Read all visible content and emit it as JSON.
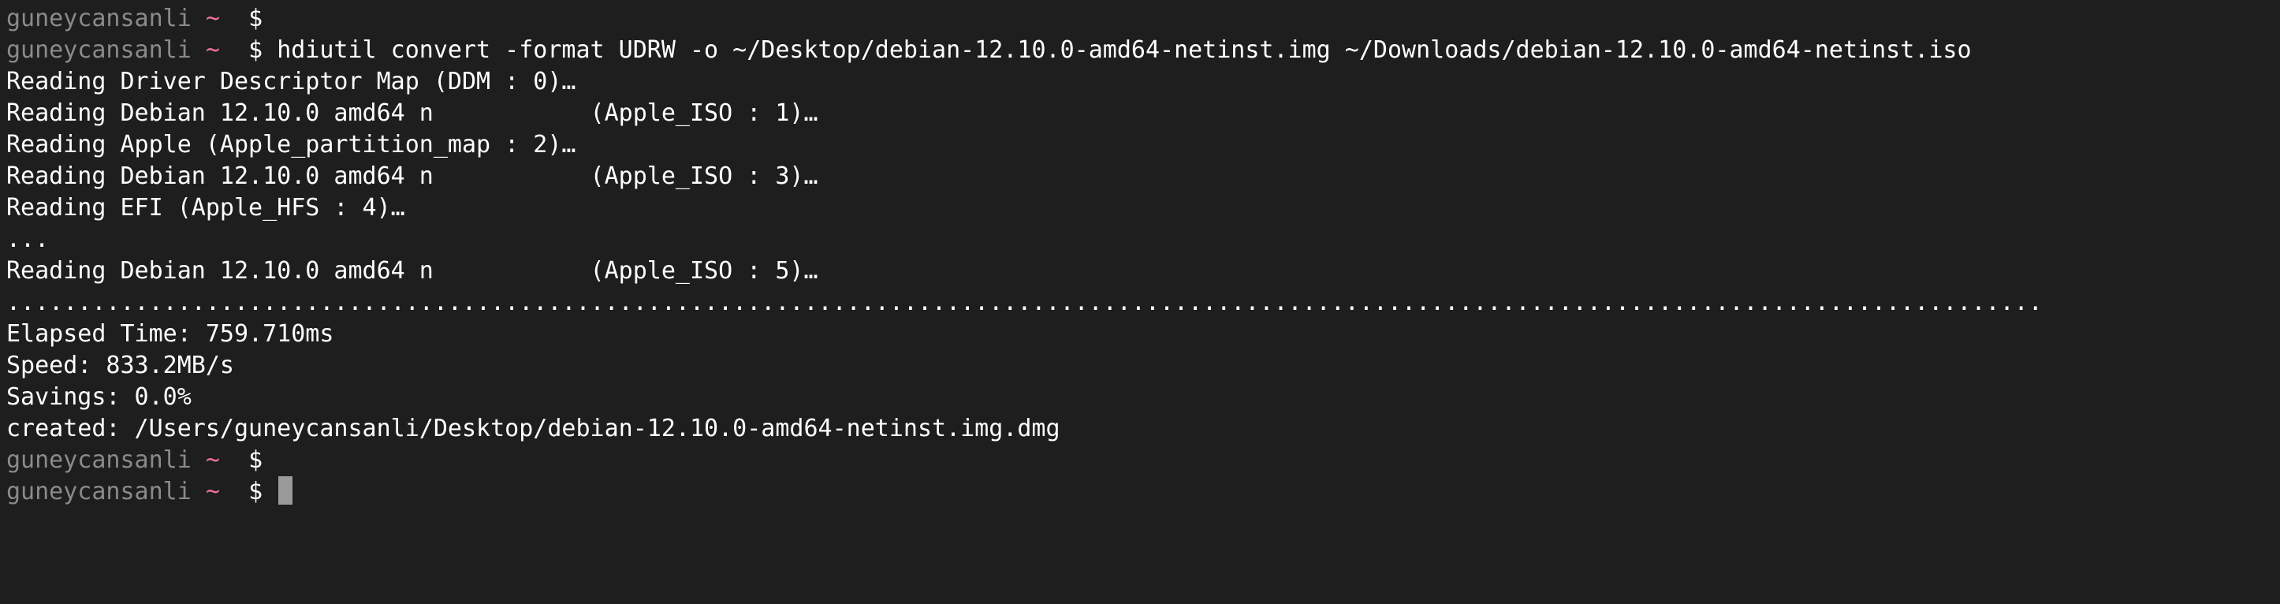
{
  "prompt": {
    "user": "guneycansanli",
    "tilde": "~",
    "symbol": "$"
  },
  "command": "hdiutil convert -format UDRW -o ~/Desktop/debian-12.10.0-amd64-netinst.img ~/Downloads/debian-12.10.0-amd64-netinst.iso",
  "output": {
    "lines": [
      "Reading Driver Descriptor Map (DDM : 0)…",
      "Reading Debian 12.10.0 amd64 n           (Apple_ISO : 1)…",
      "Reading Apple (Apple_partition_map : 2)…",
      "Reading Debian 12.10.0 amd64 n           (Apple_ISO : 3)…",
      "Reading EFI (Apple_HFS : 4)…",
      "...",
      "Reading Debian 12.10.0 amd64 n           (Apple_ISO : 5)…",
      "...............................................................................................................................................",
      "Elapsed Time: 759.710ms",
      "Speed: 833.2MB/s",
      "Savings: 0.0%",
      "created: /Users/guneycansanli/Desktop/debian-12.10.0-amd64-netinst.img.dmg"
    ]
  },
  "colors": {
    "background": "#1e1e1e",
    "text": "#ffffff",
    "prompt_user": "#8a8a8a",
    "prompt_tilde": "#f070a0",
    "cursor": "#9a9a9a"
  }
}
